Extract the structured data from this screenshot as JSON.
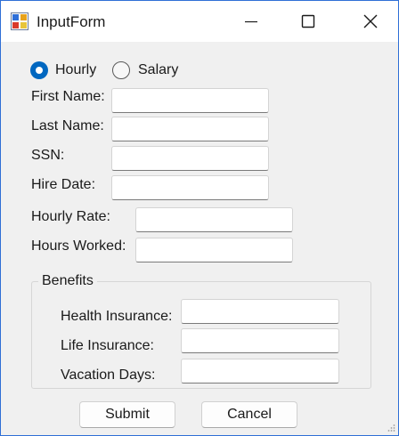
{
  "window": {
    "title": "InputForm"
  },
  "titlebar_buttons": {
    "minimize_icon": "minimize-icon",
    "maximize_icon": "maximize-icon",
    "close_icon": "close-icon"
  },
  "pay_type": {
    "options": [
      {
        "label": "Hourly",
        "checked": true
      },
      {
        "label": "Salary",
        "checked": false
      }
    ]
  },
  "fields": {
    "first_name": {
      "label": "First Name:",
      "value": ""
    },
    "last_name": {
      "label": "Last Name:",
      "value": ""
    },
    "ssn": {
      "label": "SSN:",
      "value": ""
    },
    "hire_date": {
      "label": "Hire Date:",
      "value": ""
    },
    "hourly_rate": {
      "label": "Hourly Rate:",
      "value": ""
    },
    "hours_worked": {
      "label": "Hours Worked:",
      "value": ""
    }
  },
  "benefits": {
    "legend": "Benefits",
    "health_insurance": {
      "label": "Health Insurance:",
      "value": ""
    },
    "life_insurance": {
      "label": "Life Insurance:",
      "value": ""
    },
    "vacation_days": {
      "label": "Vacation Days:",
      "value": ""
    }
  },
  "actions": {
    "submit_label": "Submit",
    "cancel_label": "Cancel"
  },
  "colors": {
    "accent": "#0067c0",
    "window_border": "#2f6fd6",
    "background": "#f0f0f0"
  }
}
